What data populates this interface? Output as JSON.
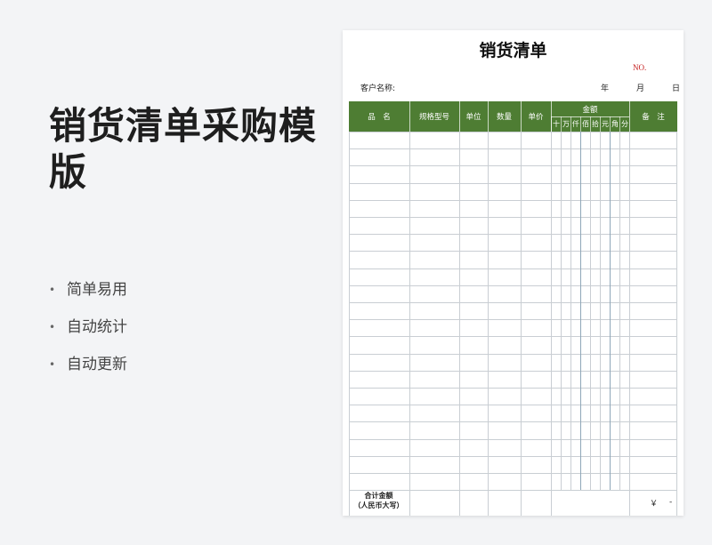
{
  "hero": {
    "title": "销货清单采购模版",
    "features": [
      "简单易用",
      "自动统计",
      "自动更新"
    ],
    "bullet": "•"
  },
  "sheet": {
    "title": "销货清单",
    "no_label": "NO.",
    "customer_label": "客户名称:",
    "year_label": "年",
    "month_label": "月",
    "day_label": "日",
    "columns": {
      "name": "品　名",
      "spec": "规格型号",
      "unit": "单位",
      "qty": "数量",
      "price": "单价",
      "amount": "金额",
      "note": "备　注"
    },
    "amount_digits": [
      "十",
      "万",
      "仟",
      "佰",
      "拾",
      "元",
      "角",
      "分"
    ],
    "total_label_1": "合计金额",
    "total_label_2": "（人民币大写）",
    "currency_symbol": "￥",
    "total_dash": "-"
  },
  "colors": {
    "header_green": "#4e7d33",
    "no_red": "#c62020",
    "grid_line": "#c9ced3"
  }
}
